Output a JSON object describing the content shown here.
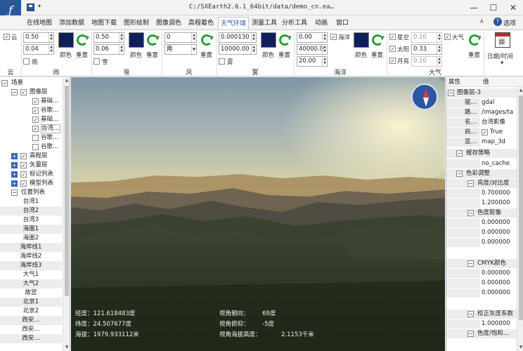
{
  "window": {
    "title": "C:/SXEarth2.6.1_64bit/data/demo_cn.ea…",
    "app_icon_glyph": "ƒ",
    "minimize_glyph": "—",
    "maximize_glyph": "☐",
    "close_glyph": "✕"
  },
  "menu": {
    "tabs": [
      "在线地图",
      "添加数据",
      "地图下载",
      "图形绘制",
      "图像调色",
      "高程着色",
      "天气环境",
      "测量工具",
      "分析工具",
      "动画",
      "窗口"
    ],
    "active_index": 6,
    "options_label": "选项",
    "help_glyph": "?",
    "collapse_glyph": "∧"
  },
  "ribbon": {
    "cloud": {
      "check_label": "云",
      "group_label": "云",
      "checked": true
    },
    "rain": {
      "value1": "0.50",
      "value2": "0.04",
      "color_label": "颜色",
      "reset_label": "重置",
      "check_label": "雨",
      "group_label": "雨",
      "swatch_color": "#0f1f5a"
    },
    "snow": {
      "value1": "0.50",
      "value2": "0.06",
      "color_label": "颜色",
      "reset_label": "重置",
      "check_label": "雪",
      "group_label": "雪",
      "swatch_color": "#0f1f5a"
    },
    "wind": {
      "value1": "0",
      "direction": "南",
      "reset_label": "重置",
      "group_label": "风"
    },
    "fog": {
      "value1": "0.000130",
      "value2": "10000.00",
      "color_label": "颜色",
      "reset_label": "重置",
      "check_label": "雾",
      "group_label": "雾",
      "swatch_color": "#0f1f5a"
    },
    "ocean": {
      "value1": "0.00",
      "value2": "40000.0",
      "value3": "20.00",
      "check_label": "海洋",
      "color_label": "颜色",
      "reset_label": "重置",
      "group_label": "海洋",
      "swatch_color": "#0f1f5a",
      "checked": true
    },
    "atmosphere": {
      "star_label": "星空",
      "star_value": "0.10",
      "sun_label": "太阳",
      "sun_value": "0.33",
      "moon_label": "月亮",
      "moon_value": "0.10",
      "atmo_label": "大气",
      "reset_label": "重置",
      "group_label": "大气"
    },
    "datetime": {
      "label": "日期/时间",
      "arrow": "▾"
    }
  },
  "tree": {
    "root": "场景",
    "image_layer": "图像层",
    "image_children": [
      "基础…",
      "谷歌…",
      "基础…",
      "台湾…",
      "谷歌…",
      "谷歌…"
    ],
    "layers": [
      "高程层",
      "矢量层",
      "标记列表",
      "模型列表"
    ],
    "location_list": "位置列表",
    "locations": [
      "台湾1",
      "台湾2",
      "台湾3",
      "海面1",
      "海面2",
      "海岸线1",
      "海岸线2",
      "海岸线3",
      "大气1",
      "大气2",
      "故宫",
      "北京1",
      "北京2",
      "西安…",
      "西安…",
      "西安…"
    ]
  },
  "viewport": {
    "longitude": "经度：121.618483度",
    "latitude": "纬度：24.507677度",
    "altitude": "海拔：1979.933112米",
    "heading_label": "视角朝向：",
    "heading_value": "69度",
    "pitch_label": "视角俯仰：",
    "pitch_value": "-5度",
    "eye_alt_label": "视角海拔高度：",
    "eye_alt_value": "2.1153千米"
  },
  "props": {
    "col_attr": "属性",
    "col_value": "值",
    "layer_name": "图像层-3",
    "rows": [
      {
        "k": "驱…",
        "v": "gdal"
      },
      {
        "k": "路…",
        "v": "/images/ta"
      },
      {
        "k": "名…",
        "v": "台湾影像"
      },
      {
        "k": "启…",
        "v": "True"
      },
      {
        "k": "显…",
        "v": "map_3d"
      }
    ],
    "cache_label": "缓存策略",
    "cache_value": "no_cache",
    "color_adjust": "色彩调整",
    "brightness_label": "亮度/对比度",
    "brightness_values": [
      "0.700000",
      "1.200000"
    ],
    "hue_label": "色度抠像",
    "hue_values": [
      "0.000000",
      "0.000000",
      "0.000000"
    ],
    "cmyk_label": "CMYK颜色",
    "cmyk_values": [
      "0.000000",
      "0.000000",
      "0.000000"
    ],
    "gray_label": "校正灰度系数",
    "gray_value": "1.000000",
    "last_label": "色度/饱和…"
  }
}
